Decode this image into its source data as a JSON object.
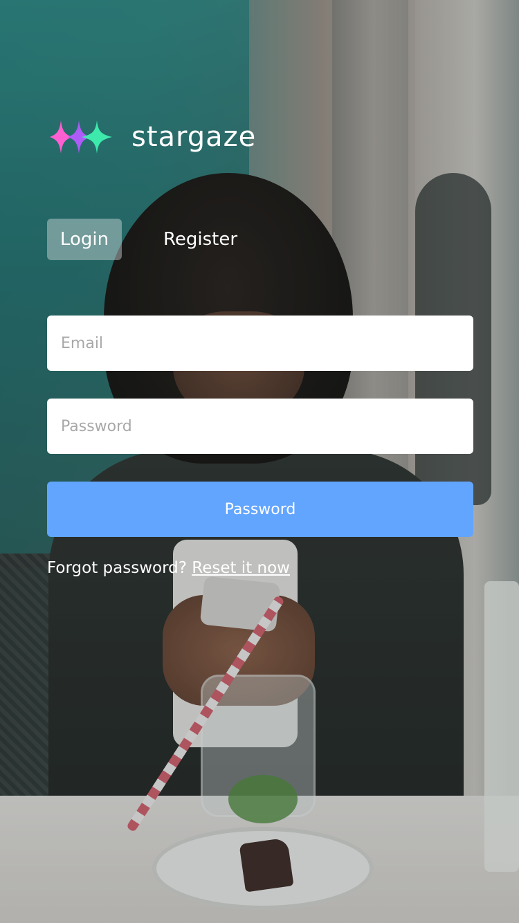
{
  "brand": {
    "name": "stargaze",
    "logo_colors": [
      "#ff5fd0",
      "#b45cff",
      "#3ff0b0"
    ]
  },
  "tabs": [
    {
      "label": "Login",
      "active": true
    },
    {
      "label": "Register",
      "active": false
    }
  ],
  "form": {
    "email_placeholder": "Email",
    "password_placeholder": "Password",
    "submit_label": "Password"
  },
  "forgot": {
    "text": "Forgot password?",
    "link_label": "Reset it now"
  },
  "colors": {
    "primary": "#62a5ff",
    "text_on_dark": "#ffffff"
  }
}
